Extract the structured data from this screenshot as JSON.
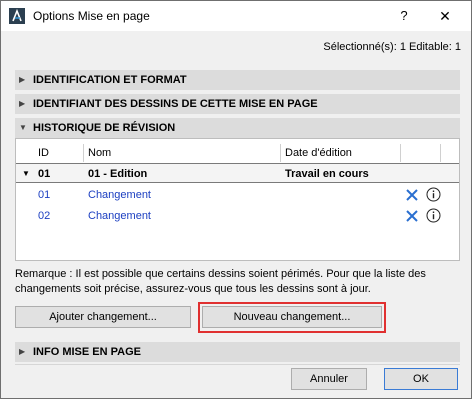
{
  "window": {
    "title": "Options Mise en page",
    "help_glyph": "?",
    "close_glyph": "✕"
  },
  "selection_info": "Sélectionné(s): 1 Editable: 1",
  "sections": {
    "identification": "IDENTIFICATION ET FORMAT",
    "identifiant": "IDENTIFIANT DES DESSINS DE CETTE MISE EN PAGE",
    "historique": "HISTORIQUE DE RÉVISION",
    "info": "INFO MISE EN PAGE"
  },
  "table": {
    "headers": [
      "ID",
      "Nom",
      "Date d'édition"
    ],
    "edition_row": {
      "id": "01",
      "name": "01 - Edition",
      "date": "Travail en cours"
    },
    "change_rows": [
      {
        "id": "01",
        "name": "Changement"
      },
      {
        "id": "02",
        "name": "Changement"
      }
    ]
  },
  "remark": "Remarque : Il est possible que certains dessins soient périmés. Pour que la liste des changements soit précise, assurez-vous que tous les dessins sont à jour.",
  "buttons": {
    "add_change": "Ajouter changement...",
    "new_change": "Nouveau changement...",
    "cancel": "Annuler",
    "ok": "OK"
  },
  "colors": {
    "accent_blue": "#1c3fc1",
    "highlight_red": "#e03030"
  },
  "icons": {
    "app": "archicad-logo-icon",
    "delete": "delete-x-icon",
    "info": "info-icon",
    "collapsed": "triangle-right-icon",
    "expanded": "triangle-down-icon"
  }
}
